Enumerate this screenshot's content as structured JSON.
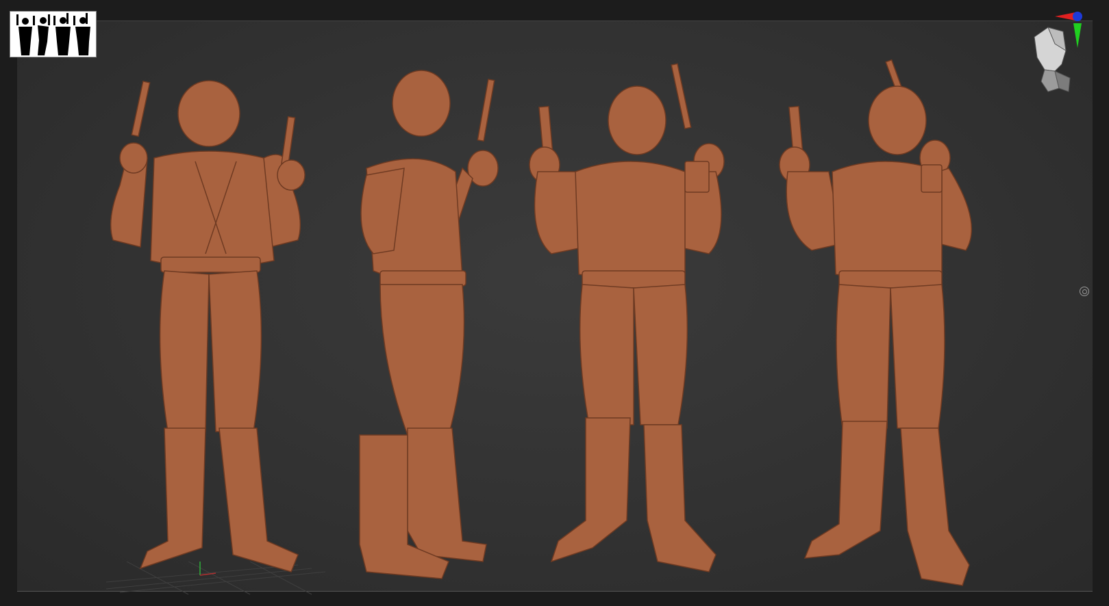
{
  "scene": {
    "views": [
      "back",
      "side",
      "front-three-quarter",
      "front-right"
    ],
    "material_color": "#a9623f",
    "background_color": "#333333"
  },
  "widgets": {
    "reference_thumbnail_icon": "figure-silhouettes-icon",
    "axis_gizmo_icon": "axis-gizmo-icon",
    "navigation_head_icon": "nav-head-icon",
    "pivot_icon": "pivot-circle-icon"
  }
}
